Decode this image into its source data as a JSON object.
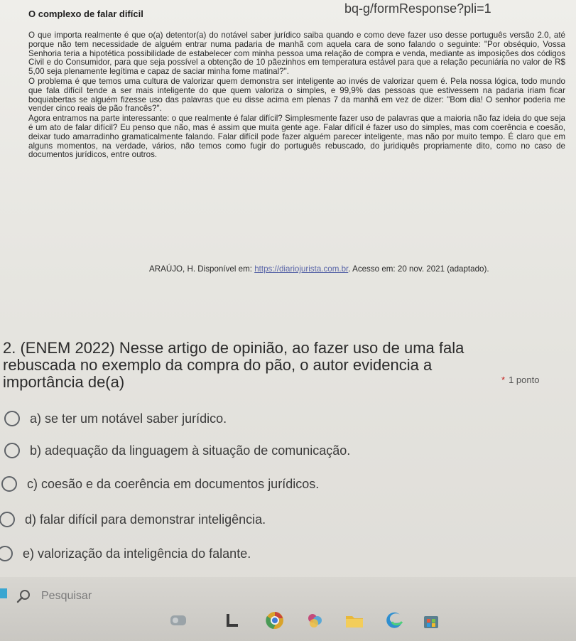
{
  "address_fragment": "bq-g/formResponse?pli=1",
  "article": {
    "title": "O complexo de falar difícil",
    "paragraphs": [
      "O que importa realmente é que o(a) detentor(a) do notável saber jurídico saiba quando e como deve fazer uso desse português versão 2.0, até porque não tem necessidade de alguém entrar numa padaria de manhã com aquela cara de sono falando o seguinte: \"Por obséquio, Vossa Senhoria teria a hipotética possibilidade de estabelecer com minha pessoa uma relação de compra e venda, mediante as imposições dos códigos Civil e do Consumidor, para que seja possível a obtenção de 10 pãezinhos em temperatura estável para que a relação pecuniária no valor de R$ 5,00 seja plenamente legítima e capaz de saciar minha fome matinal?\".",
      "O problema é que temos uma cultura de valorizar quem demonstra ser inteligente ao invés de valorizar quem é. Pela nossa lógica, todo mundo que fala difícil tende a ser mais inteligente do que quem valoriza o simples, e 99,9% das pessoas que estivessem na padaria iriam ficar boquiabertas se alguém fizesse uso das palavras que eu disse acima em plenas 7 da manhã em vez de dizer: \"Bom dia! O senhor poderia me vender cinco reais de pão francês?\".",
      "Agora entramos na parte interessante: o que realmente é falar difícil? Simplesmente fazer uso de palavras que a maioria não faz ideia do que seja é um ato de falar difícil? Eu penso que não, mas é assim que muita gente age. Falar difícil é fazer uso do simples, mas com coerência e coesão, deixar tudo amarradinho gramaticalmente falando. Falar difícil pode fazer alguém parecer inteligente, mas não por muito tempo. É claro que em alguns momentos, na verdade, vários, não temos como fugir do português rebuscado, do juridiquês propriamente dito, como no caso de documentos jurídicos, entre outros."
    ],
    "source_prefix": "ARAÚJO, H. Disponível em: ",
    "source_link": "https://diariojurista.com.br",
    "source_suffix": ". Acesso em: 20 nov. 2021 (adaptado)."
  },
  "question": {
    "text": "2. (ENEM 2022) Nesse artigo de opinião, ao fazer uso de uma fala rebuscada no exemplo da compra do pão, o autor evidencia a importância de(a)",
    "required_mark": "*",
    "points": "1 ponto"
  },
  "options": [
    {
      "label": "a) se ter um notável saber jurídico."
    },
    {
      "label": "b) adequação da linguagem à situação de comunicação."
    },
    {
      "label": "c) coesão e da coerência em documentos jurídicos."
    },
    {
      "label": "d) falar difícil para demonstrar inteligência."
    },
    {
      "label": "e) valorização da inteligência do falante."
    }
  ],
  "taskbar": {
    "search_placeholder": "Pesquisar",
    "icons": [
      "widgets-icon",
      "task-view-icon",
      "chrome-icon",
      "file-explorer-icon",
      "edge-icon",
      "store-icon"
    ]
  }
}
